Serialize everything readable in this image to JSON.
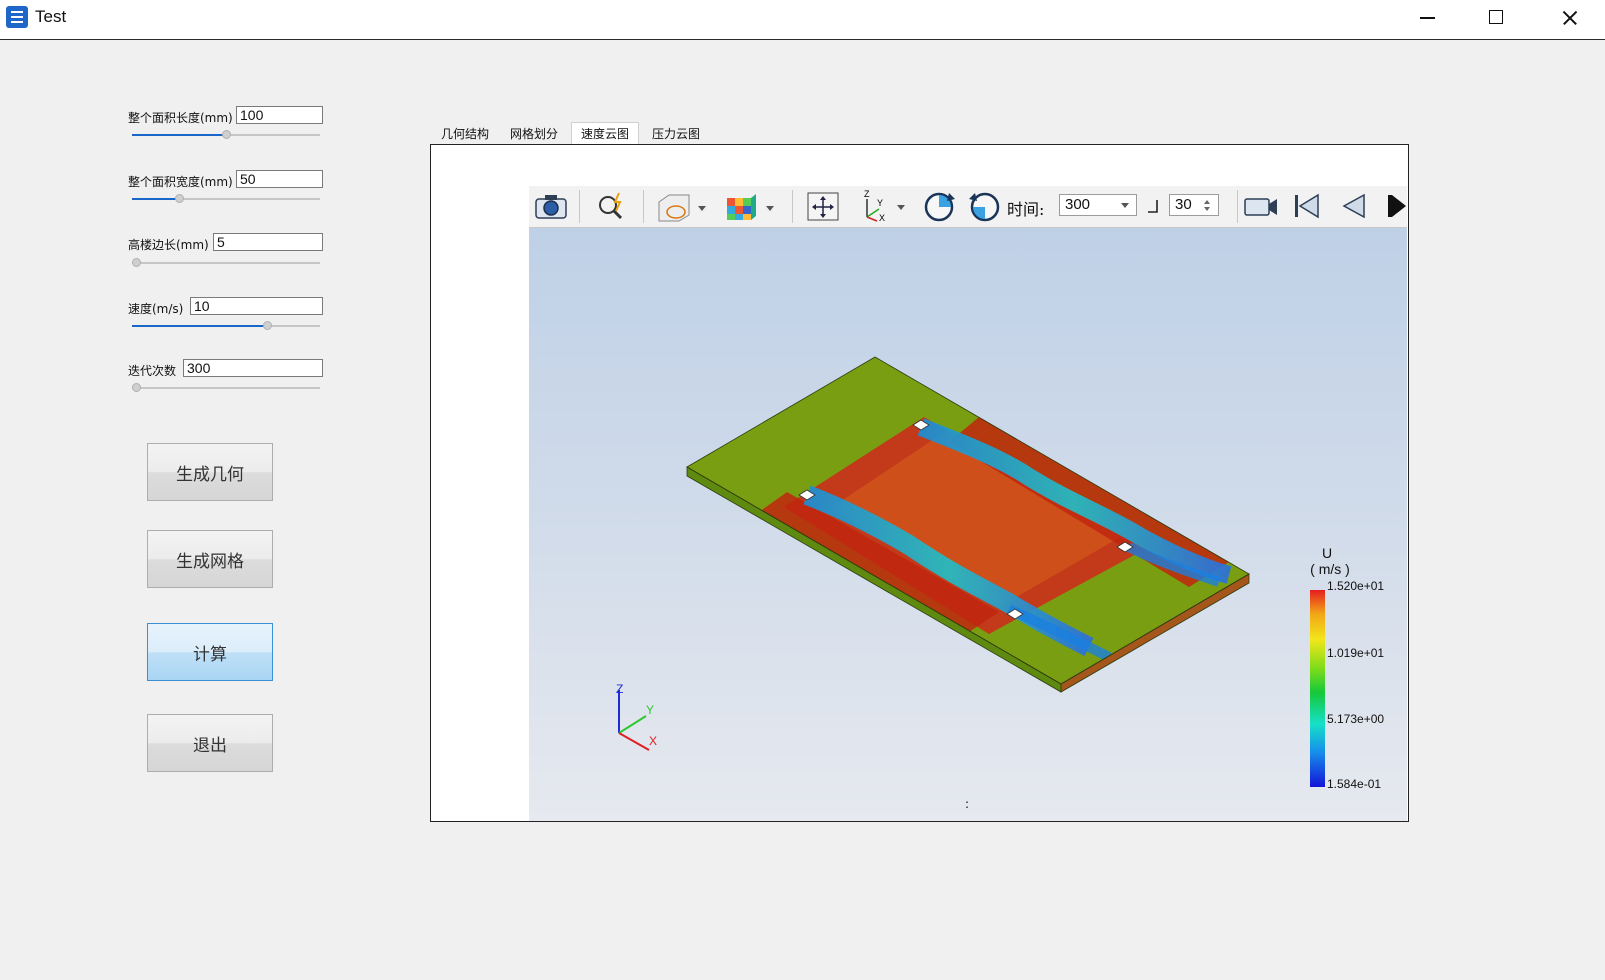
{
  "window": {
    "title": "Test"
  },
  "params": [
    {
      "label": "整个面积长度(mm)",
      "value": "100",
      "level": 0.5
    },
    {
      "label": "整个面积宽度(mm)",
      "value": "50",
      "level": 0.24
    },
    {
      "label": "高楼边长(mm)",
      "value": "5",
      "level": 0.0
    },
    {
      "label": "速度(m/s)",
      "value": "10",
      "level": 0.73
    },
    {
      "label": "迭代次数",
      "value": "300",
      "level": 0.0
    }
  ],
  "buttons": {
    "generate_geometry": "生成几何",
    "generate_mesh": "生成网格",
    "compute": "计算",
    "exit": "退出"
  },
  "tabs": [
    "几何结构",
    "网格划分",
    "速度云图",
    "压力云图"
  ],
  "selected_tab": "速度云图",
  "toolbar": {
    "time_label": "时间:",
    "time_value": "300",
    "frame_value": "30",
    "icons": [
      "camera-icon",
      "zoom-icon",
      "display-mode-icon",
      "colormap-icon",
      "fit-view-icon",
      "axes-orientation-icon",
      "rotate-cw-icon",
      "rotate-ccw-icon",
      "record-icon",
      "first-frame-icon",
      "previous-frame-icon",
      "next-frame-icon"
    ]
  },
  "legend": {
    "title": "U",
    "unit": "( m/s )",
    "labels": [
      "1.520e+01",
      "1.019e+01",
      "5.173e+00",
      "1.584e-01"
    ]
  },
  "axes": {
    "x": "X",
    "y": "Y",
    "z": "Z"
  },
  "status": ":"
}
